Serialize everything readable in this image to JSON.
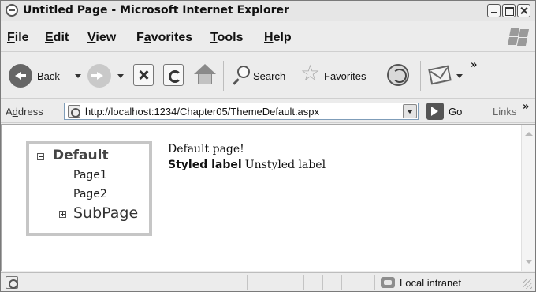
{
  "window": {
    "title": "Untitled Page - Microsoft Internet Explorer"
  },
  "menu": {
    "items": [
      {
        "ul": "F",
        "rest": "ile"
      },
      {
        "ul": "E",
        "rest": "dit"
      },
      {
        "ul": "V",
        "rest": "iew"
      },
      {
        "pre": "F",
        "ul": "a",
        "rest": "vorites"
      },
      {
        "ul": "T",
        "rest": "ools"
      },
      {
        "ul": "H",
        "rest": "elp"
      }
    ]
  },
  "toolbar": {
    "back_label": "Back",
    "search_label": "Search",
    "favorites_label": "Favorites",
    "overflow": "»"
  },
  "address": {
    "label_pre": "A",
    "label_ul": "d",
    "label_rest": "dress",
    "url": "http://localhost:1234/Chapter05/ThemeDefault.aspx",
    "go_label": "Go",
    "links_label": "Links",
    "overflow": "»"
  },
  "content": {
    "tree": {
      "root": "Default",
      "pages": [
        "Page1",
        "Page2"
      ],
      "subpage": "SubPage"
    },
    "page_text": "Default page!",
    "styled_label": "Styled label",
    "unstyled_label": "Unstyled label"
  },
  "status": {
    "zone": "Local intranet"
  }
}
